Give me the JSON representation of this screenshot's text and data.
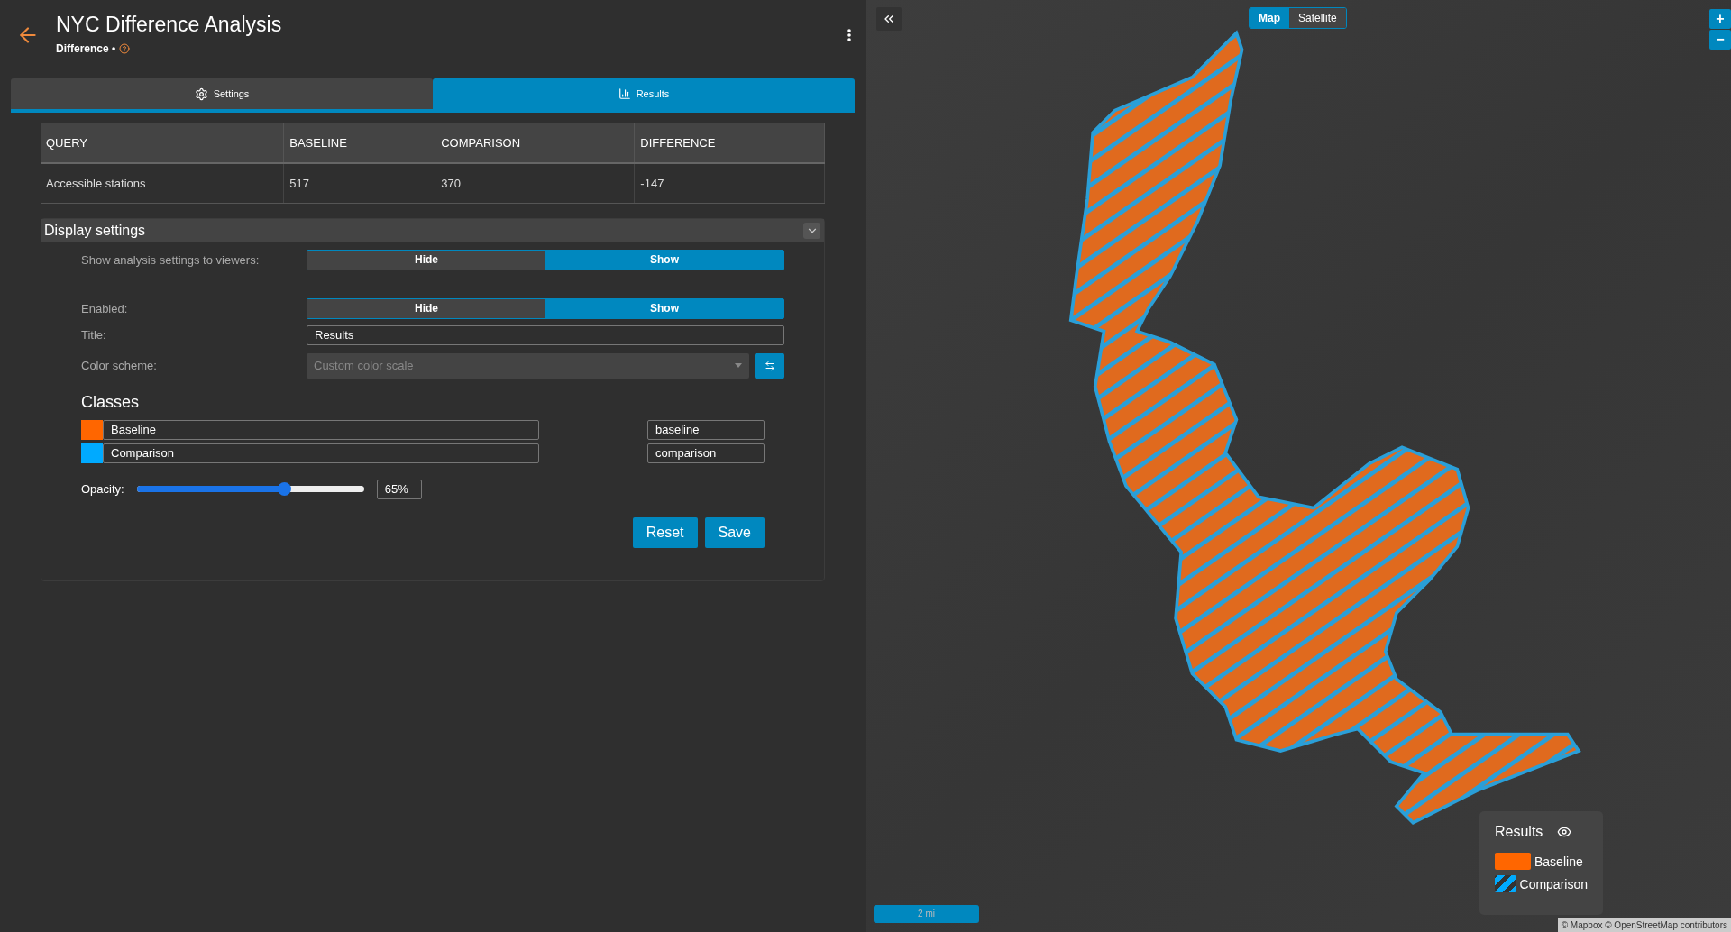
{
  "header": {
    "title": "NYC Difference Analysis",
    "subtitle": "Difference •"
  },
  "tabs": [
    {
      "label": "Settings",
      "selected": false
    },
    {
      "label": "Results",
      "selected": true
    }
  ],
  "results_table": {
    "columns": [
      "QUERY",
      "BASELINE",
      "COMPARISON",
      "DIFFERENCE"
    ],
    "rows": [
      [
        "Accessible stations",
        "517",
        "370",
        "-147"
      ]
    ]
  },
  "display_settings": {
    "title": "Display settings",
    "expanded": true,
    "toggles": [
      {
        "label": "Show analysis settings to viewers:",
        "options": [
          {
            "label": "Hide",
            "selected": false
          },
          {
            "label": "Show",
            "selected": true
          }
        ]
      },
      {
        "label": "Enabled:",
        "options": [
          {
            "label": "Hide",
            "selected": false
          },
          {
            "label": "Show",
            "selected": true
          }
        ]
      }
    ],
    "title_field": {
      "label": "Title:",
      "value": "Results"
    },
    "color_scheme": {
      "label": "Color scheme:",
      "value": "Custom color scale"
    },
    "classes_heading": "Classes",
    "classes": [
      {
        "name": "Baseline",
        "key": "baseline",
        "color": "#ff6600"
      },
      {
        "name": "Comparison",
        "key": "comparison",
        "color": "#00aaff"
      }
    ],
    "opacity": {
      "label": "Opacity:",
      "level": 0.65,
      "reading": "65%"
    },
    "buttons": [
      "Reset",
      "Save"
    ]
  },
  "map": {
    "modes": [
      {
        "label": "Map",
        "selected": true
      },
      {
        "label": "Satellite",
        "selected": false
      }
    ],
    "zoom_buttons": [
      "+",
      "−"
    ],
    "scale": "2 mi",
    "attribution": "© Mapbox © OpenStreetMap contributors",
    "legend": {
      "title": "Results",
      "items": [
        {
          "label": "Baseline",
          "kind": "solid",
          "color": "#ff6600"
        },
        {
          "label": "Comparison",
          "kind": "hatched",
          "color": "#00aaff"
        }
      ]
    }
  }
}
